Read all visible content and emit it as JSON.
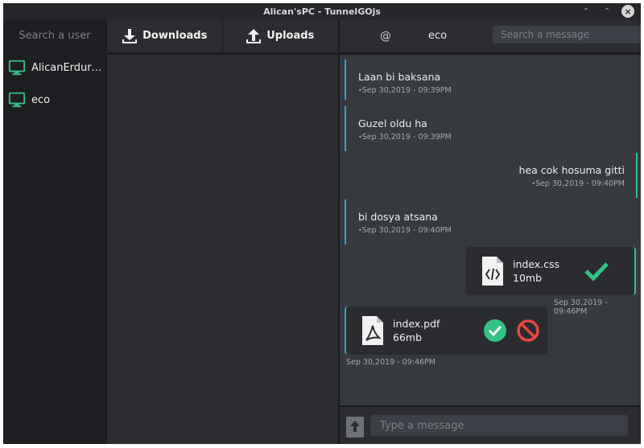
{
  "window": {
    "title": "Alican'sPC - TunnelGOjs"
  },
  "users": {
    "search_placeholder": "Search a user",
    "items": [
      {
        "name": "AlicanErdurm..",
        "icon": "monitor-icon"
      },
      {
        "name": "eco",
        "icon": "monitor-icon"
      }
    ]
  },
  "transfers": {
    "tabs": [
      {
        "label": "Downloads",
        "icon": "download-icon"
      },
      {
        "label": "Uploads",
        "icon": "upload-icon"
      }
    ]
  },
  "chat": {
    "at_symbol": "@",
    "user": "eco",
    "search_placeholder": "Search a message",
    "messages": [
      {
        "direction": "in",
        "text": "Laan bi baksana",
        "time": "Sep 30,2019 - 09:39PM"
      },
      {
        "direction": "in",
        "text": "Guzel oldu ha",
        "time": "Sep 30,2019 - 09:39PM"
      },
      {
        "direction": "out",
        "text": "hea cok hosuma gitti",
        "time": "Sep 30,2019 - 09:40PM"
      },
      {
        "direction": "in",
        "text": "bi dosya atsana",
        "time": "Sep 30,2019 - 09:40PM"
      }
    ],
    "files": [
      {
        "direction": "out",
        "name": "index.css",
        "size": "10mb",
        "time": "Sep 30,2019 - 09:46PM",
        "icon": "code-file-icon",
        "status": "accepted"
      },
      {
        "direction": "in",
        "name": "index.pdf",
        "size": "66mb",
        "time": "Sep 30,2019 - 09:46PM",
        "icon": "pdf-file-icon",
        "actions": [
          "accept",
          "reject"
        ]
      }
    ],
    "composer_placeholder": "Type a message"
  },
  "colors": {
    "incoming": "#2aa2d8",
    "outgoing": "#34c286",
    "accept": "#34c286",
    "reject": "#e5483e",
    "monitor": "#34c286"
  }
}
